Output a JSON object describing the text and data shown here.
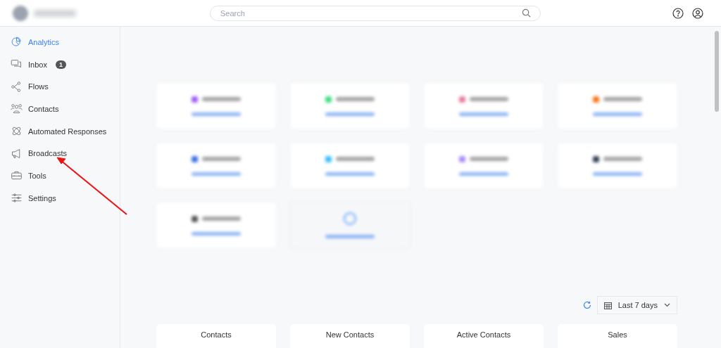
{
  "header": {
    "search": {
      "placeholder": "Search"
    }
  },
  "sidebar": {
    "items": [
      {
        "label": "Analytics",
        "selected": true
      },
      {
        "label": "Inbox",
        "selected": false,
        "badge": "1"
      },
      {
        "label": "Flows",
        "selected": false
      },
      {
        "label": "Contacts",
        "selected": false
      },
      {
        "label": "Automated Responses",
        "selected": false
      },
      {
        "label": "Broadcasts",
        "selected": false
      },
      {
        "label": "Tools",
        "selected": false
      },
      {
        "label": "Settings",
        "selected": false
      }
    ]
  },
  "channels": [
    {
      "kind": "channel"
    },
    {
      "kind": "channel"
    },
    {
      "kind": "channel"
    },
    {
      "kind": "channel"
    },
    {
      "kind": "channel"
    },
    {
      "kind": "channel"
    },
    {
      "kind": "channel"
    },
    {
      "kind": "channel"
    },
    {
      "kind": "channel"
    },
    {
      "kind": "add"
    }
  ],
  "period": {
    "value": "Last 7 days"
  },
  "stats": [
    {
      "label": "Contacts"
    },
    {
      "label": "New Contacts"
    },
    {
      "label": "Active Contacts"
    },
    {
      "label": "Sales"
    }
  ]
}
